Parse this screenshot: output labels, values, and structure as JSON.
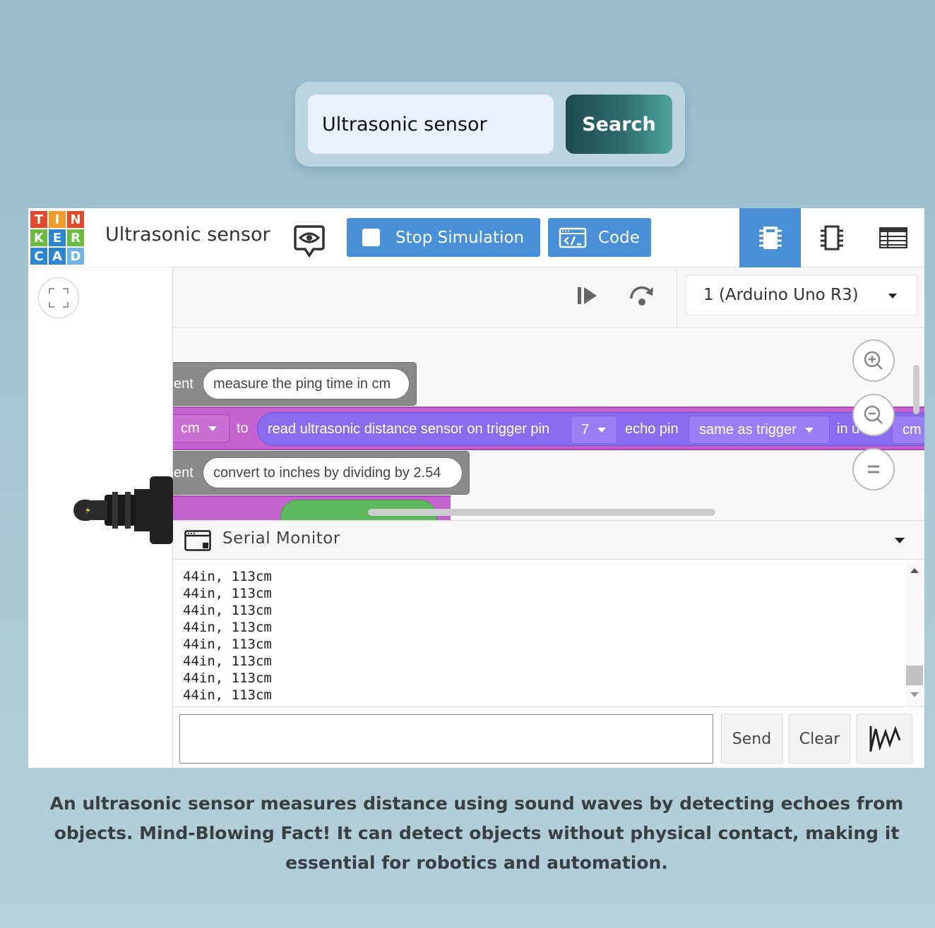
{
  "search": {
    "value": "Ultrasonic sensor",
    "button_label": "Search"
  },
  "app": {
    "logo_letters": [
      "T",
      "I",
      "N",
      "K",
      "E",
      "R",
      "C",
      "A",
      "D"
    ],
    "title": "Ultrasonic sensor",
    "stop_label": "Stop Simulation",
    "code_label": "Code",
    "device": "1 (Arduino Uno R3)"
  },
  "blocks": {
    "comment1_prefix": "ent",
    "comment1_text": "measure the ping time in cm",
    "set_var": "cm",
    "to": "to",
    "read_label": "read ultrasonic distance sensor on trigger pin",
    "trigger_pin": "7",
    "echo_label": "echo pin",
    "echo_value": "same as trigger",
    "units_prefix": "in u",
    "units_cut": "cm",
    "comment2_prefix": "ent",
    "comment2_text": "convert to inches by dividing by 2.54"
  },
  "serial": {
    "title": "Serial Monitor",
    "lines": [
      "44in, 113cm",
      "44in, 113cm",
      "44in, 113cm",
      "44in, 113cm",
      "44in, 113cm",
      "44in, 113cm",
      "44in, 113cm",
      "44in, 113cm"
    ],
    "send_label": "Send",
    "clear_label": "Clear"
  },
  "caption": "An ultrasonic sensor measures distance using sound waves by detecting echoes from objects. Mind-Blowing Fact! It can detect objects without physical contact, making it essential for robotics and automation.",
  "colors": {
    "blue_accent": "#4a90d9",
    "block_purple": "#c361cf",
    "block_violet": "#8a6cf0",
    "comment_gray": "#8a8a8a"
  }
}
